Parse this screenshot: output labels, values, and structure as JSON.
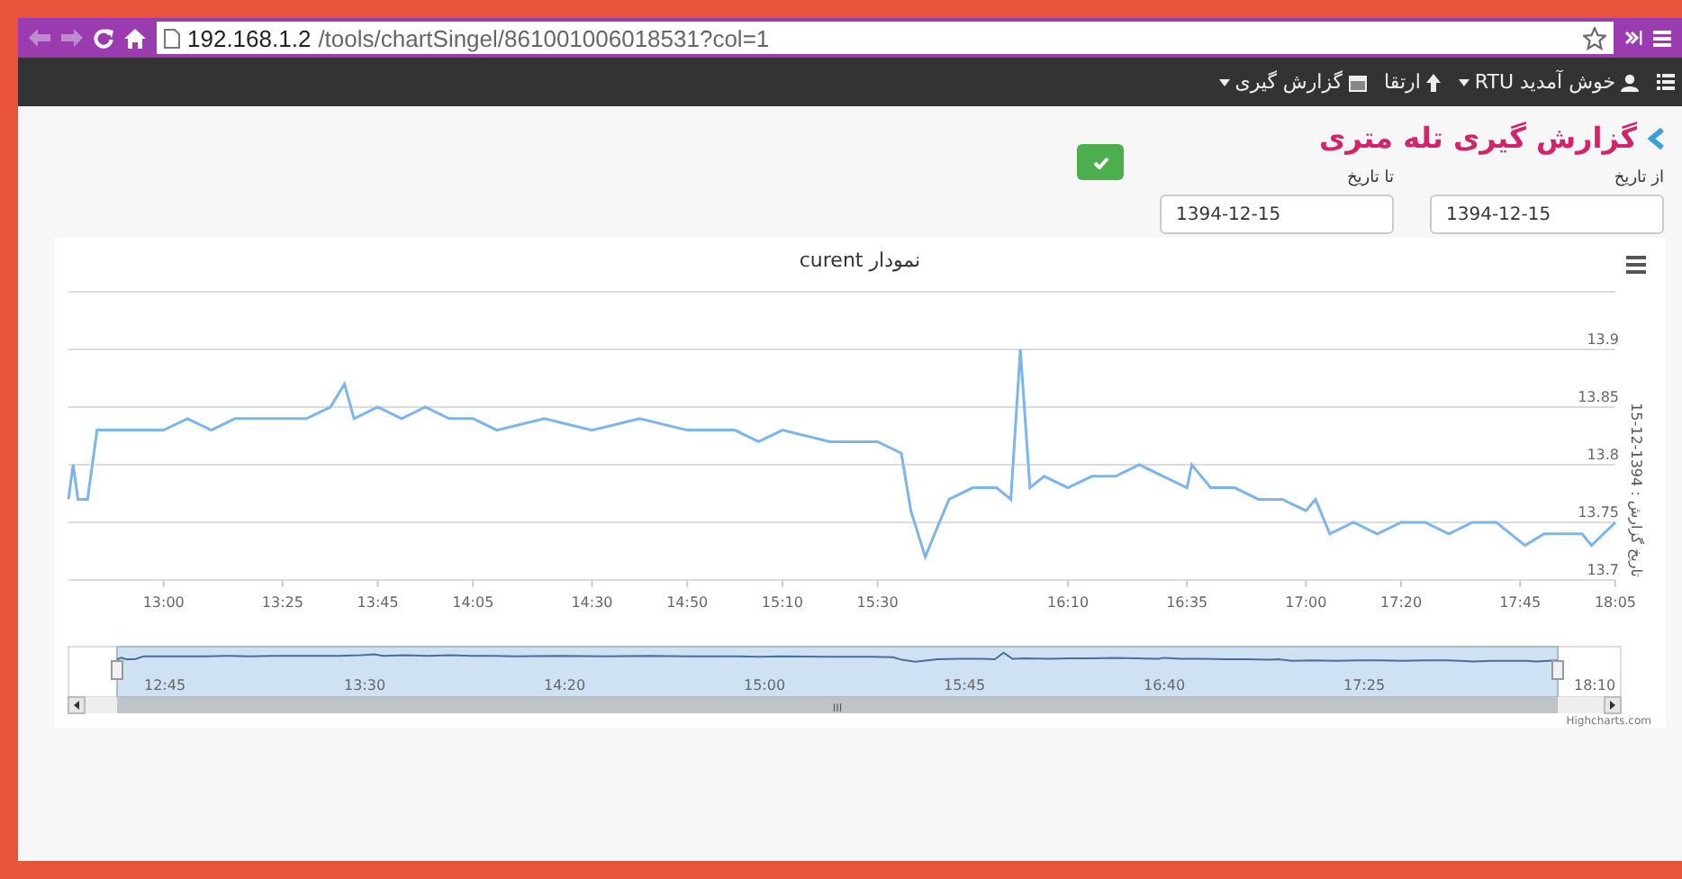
{
  "browser": {
    "url_host": "192.168.1.2",
    "url_path": "/tools/chartSingel/861001006018531?col=1",
    "back_disabled": true,
    "forward_disabled": true
  },
  "navbar": {
    "items": [
      {
        "kind": "user",
        "label": "خوش آمدید RTU",
        "dropdown": true
      },
      {
        "kind": "upgrade",
        "label": "ارتقا",
        "dropdown": false
      },
      {
        "kind": "report",
        "label": "گزارش گیری",
        "dropdown": true
      }
    ]
  },
  "page_title": "گزارش گیری تله متری",
  "from_date": {
    "label": "از تاریخ",
    "value": "1394-12-15"
  },
  "to_date": {
    "label": "تا تاریخ",
    "value": "1394-12-15"
  },
  "chart": {
    "chart_data": {
      "type": "line",
      "title": "curent نمودار",
      "ylabel": "تاریخ گزارش : 1394-12-15",
      "xlim": [
        760,
        1085
      ],
      "grid": true,
      "ylim": [
        13.7,
        13.95
      ],
      "yticks": [
        13.7,
        13.75,
        13.8,
        13.85,
        13.9
      ],
      "xticks": [
        {
          "value": 780,
          "label": "13:00"
        },
        {
          "value": 805,
          "label": "13:25"
        },
        {
          "value": 825,
          "label": "13:45"
        },
        {
          "value": 845,
          "label": "14:05"
        },
        {
          "value": 870,
          "label": "14:30"
        },
        {
          "value": 890,
          "label": "14:50"
        },
        {
          "value": 910,
          "label": "15:10"
        },
        {
          "value": 930,
          "label": "15:30"
        },
        {
          "value": 970,
          "label": "16:10"
        },
        {
          "value": 995,
          "label": "16:35"
        },
        {
          "value": 1020,
          "label": "17:00"
        },
        {
          "value": 1040,
          "label": "17:20"
        },
        {
          "value": 1065,
          "label": "17:45"
        },
        {
          "value": 1085,
          "label": "18:05"
        }
      ],
      "x": [
        760,
        761,
        762,
        764,
        766,
        770,
        775,
        780,
        785,
        790,
        795,
        800,
        805,
        810,
        815,
        818,
        820,
        825,
        830,
        835,
        840,
        845,
        850,
        860,
        870,
        880,
        890,
        900,
        905,
        910,
        920,
        925,
        930,
        935,
        937,
        940,
        942,
        945,
        950,
        955,
        958,
        960,
        962,
        965,
        970,
        975,
        980,
        985,
        990,
        995,
        996,
        1000,
        1005,
        1010,
        1015,
        1020,
        1022,
        1025,
        1030,
        1035,
        1040,
        1045,
        1050,
        1055,
        1060,
        1063,
        1066,
        1070,
        1075,
        1078,
        1080,
        1085
      ],
      "series": [
        {
          "color": "#7cb5ec",
          "values": [
            13.77,
            13.8,
            13.77,
            13.77,
            13.83,
            13.83,
            13.83,
            13.83,
            13.84,
            13.83,
            13.84,
            13.84,
            13.84,
            13.84,
            13.85,
            13.87,
            13.84,
            13.85,
            13.84,
            13.85,
            13.84,
            13.84,
            13.83,
            13.84,
            13.83,
            13.84,
            13.83,
            13.83,
            13.82,
            13.83,
            13.82,
            13.82,
            13.82,
            13.81,
            13.76,
            13.72,
            13.74,
            13.77,
            13.78,
            13.78,
            13.77,
            13.9,
            13.78,
            13.79,
            13.78,
            13.79,
            13.79,
            13.8,
            13.79,
            13.78,
            13.8,
            13.78,
            13.78,
            13.77,
            13.77,
            13.76,
            13.77,
            13.74,
            13.75,
            13.74,
            13.75,
            13.75,
            13.74,
            13.75,
            13.75,
            13.74,
            13.73,
            13.74,
            13.74,
            13.74,
            13.73,
            13.75
          ]
        }
      ]
    },
    "navigator_labels": [
      "12:45",
      "13:30",
      "14:20",
      "15:00",
      "15:45",
      "16:40",
      "17:25",
      "18:10"
    ],
    "scrollbar_grip": "III",
    "credit": "Highcharts.com"
  }
}
